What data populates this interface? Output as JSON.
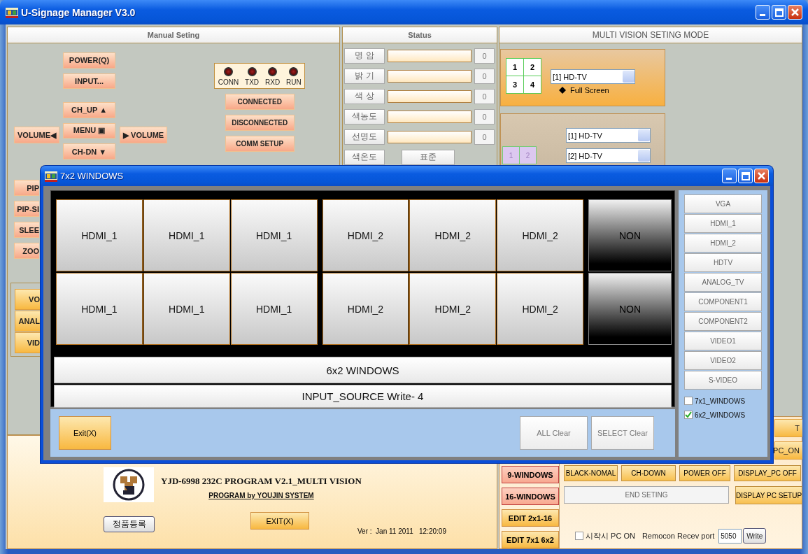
{
  "window": {
    "title": "U-Signage Manager V3.0"
  },
  "manual": {
    "header": "Manual Seting",
    "power_buttons": [
      "POWER(Q)",
      "INPUT..."
    ],
    "nav": {
      "up": "CH_UP ▲",
      "menu": "MENU ▣",
      "down": "CH-DN ▼",
      "vol_left": "VOLUME◀",
      "vol_right": "▶ VOLUME"
    },
    "leds": [
      {
        "label": "CONN",
        "on": false
      },
      {
        "label": "TXD",
        "on": false
      },
      {
        "label": "RXD",
        "on": false
      },
      {
        "label": "RUN",
        "on": false
      }
    ],
    "comm_buttons": [
      "CONNECTED",
      "DISCONNECTED",
      "COMM SETUP"
    ],
    "side_buttons": [
      "PIP",
      "PIP-SI",
      "SLEE",
      "ZOO"
    ],
    "input_buttons": [
      "VO",
      "ANAL",
      "VID"
    ]
  },
  "status": {
    "header": "Status",
    "rows": [
      {
        "label": "명 암",
        "level": 0,
        "value": "0"
      },
      {
        "label": "밝 기",
        "level": 0,
        "value": "0"
      },
      {
        "label": "색 상",
        "level": 0,
        "value": "0"
      },
      {
        "label": "색농도",
        "level": 0,
        "value": "0"
      },
      {
        "label": "선명도",
        "level": 0,
        "value": "0"
      }
    ],
    "color_temp": {
      "label": "색온도",
      "value": "표준"
    }
  },
  "multi_vision": {
    "header": "MULTI VISION SETING MODE",
    "full": {
      "grid": [
        "1",
        "2",
        "3",
        "4"
      ],
      "select": "[1] HD-TV",
      "caption": "Full Screen"
    },
    "split": {
      "grid": [
        "1",
        "2"
      ],
      "selects": [
        "[1] HD-TV",
        "[2] HD-TV"
      ]
    }
  },
  "bottom": {
    "title": "YJD-6998 232C  PROGRAM V2.1_MULTI VISION",
    "subtitle": "PROGRAM by YOUJIN SYSTEM",
    "register_button": "정품등록",
    "exit_button": "EXIT(X)",
    "version": "Ver :  Jan 11 2011   12:20:09"
  },
  "controls": {
    "partial_buttons": [
      "T",
      "PC_ON"
    ],
    "window_buttons": [
      {
        "label": "9-WINDOWS",
        "kind": "layout"
      },
      {
        "label": "16-WINDOWS",
        "kind": "layout"
      },
      {
        "label": "EDIT 2x1-16",
        "kind": "edit"
      },
      {
        "label": "EDIT 7x1 6x2",
        "kind": "edit"
      }
    ],
    "row_buttons": [
      "BLACK-NOMAL",
      "CH-DOWN",
      "POWER OFF",
      "DISPLAY_PC OFF"
    ],
    "end_button": "END SETING",
    "setup_button": "DISPLAY PC SETUP",
    "startup": {
      "label": "시작시 PC ON",
      "checked": false
    },
    "port_label": "Remocon Recev port",
    "port": "5050",
    "write_button": "Write"
  },
  "dialog": {
    "title": "7x2 WINDOWS",
    "rows": [
      [
        {
          "label": "HDMI_1",
          "kind": "input"
        },
        {
          "label": "HDMI_1",
          "kind": "input"
        },
        {
          "label": "HDMI_1",
          "kind": "input"
        },
        {
          "label": "HDMI_2",
          "kind": "input"
        },
        {
          "label": "HDMI_2",
          "kind": "input"
        },
        {
          "label": "HDMI_2",
          "kind": "input"
        },
        {
          "label": "NON",
          "kind": "empty"
        }
      ],
      [
        {
          "label": "HDMI_1",
          "kind": "input"
        },
        {
          "label": "HDMI_1",
          "kind": "input"
        },
        {
          "label": "HDMI_1",
          "kind": "input"
        },
        {
          "label": "HDMI_2",
          "kind": "input"
        },
        {
          "label": "HDMI_2",
          "kind": "input"
        },
        {
          "label": "HDMI_2",
          "kind": "input"
        },
        {
          "label": "NON",
          "kind": "empty"
        }
      ]
    ],
    "banner": "6x2 WINDOWS",
    "status": "INPUT_SOURCE  Write- 4",
    "exit_button": "Exit(X)",
    "all_clear": "ALL Clear",
    "select_clear": "SELECT Clear",
    "sources": [
      "VGA",
      "HDMI_1",
      "HDMI_2",
      "HDTV",
      "ANALOG_TV",
      "COMPONENT1",
      "COMPONENT2",
      "VIDEO1",
      "VIDEO2",
      "S-VIDEO"
    ],
    "modes": [
      {
        "label": "7x1_WINDOWS",
        "checked": false
      },
      {
        "label": "6x2_WINDOWS",
        "checked": true
      }
    ]
  }
}
